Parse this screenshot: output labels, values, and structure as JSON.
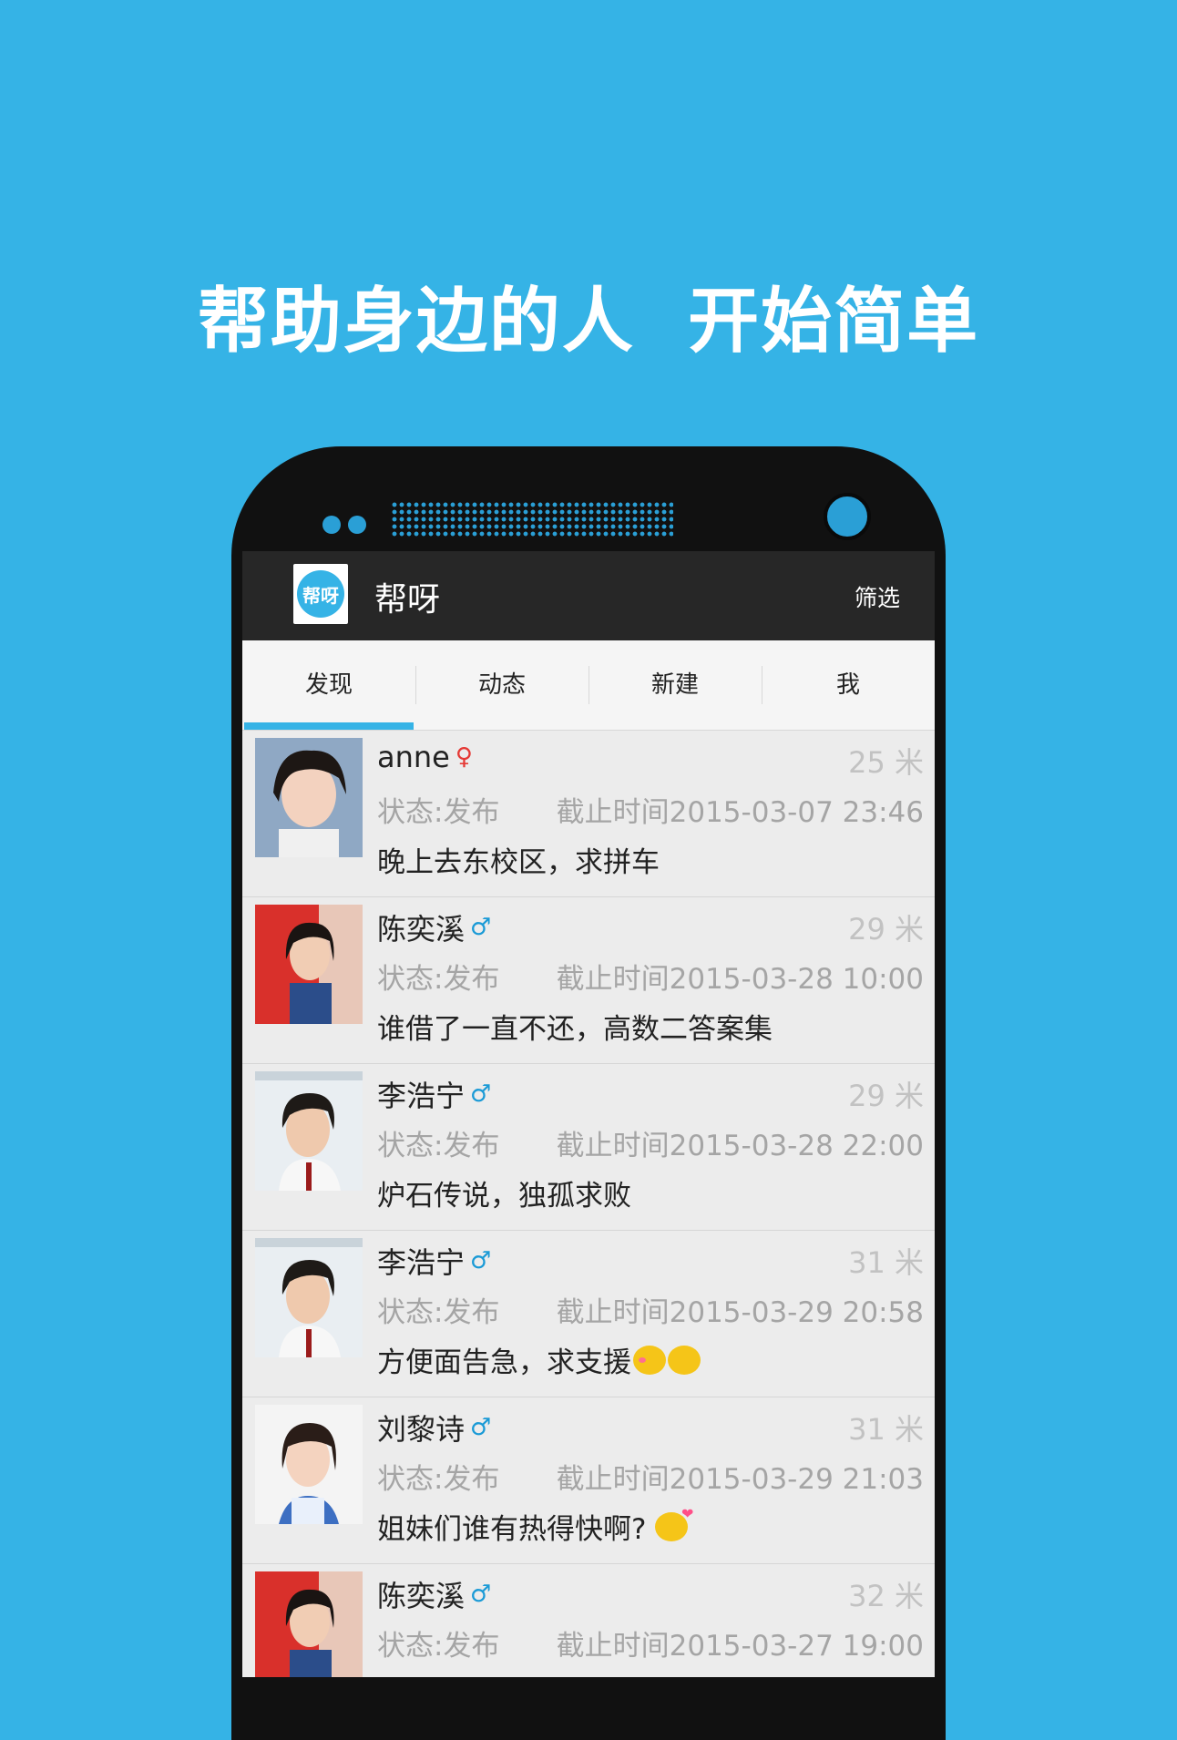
{
  "headline": "帮助身边的人  开始简单",
  "app": {
    "logo_text": "帮呀",
    "title": "帮呀",
    "filter_label": "筛选"
  },
  "tabs": [
    {
      "label": "发现",
      "active": true
    },
    {
      "label": "动态",
      "active": false
    },
    {
      "label": "新建",
      "active": false
    },
    {
      "label": "我",
      "active": false
    }
  ],
  "feed": [
    {
      "name": "anne",
      "gender": "female",
      "gender_symbol": "♀",
      "distance": "25 米",
      "status": "状态:发布",
      "deadline": "截止时间2015-03-07 23:46",
      "text": "晚上去东校区，求拼车",
      "emojis": []
    },
    {
      "name": "陈奕溪",
      "gender": "male",
      "gender_symbol": "♂",
      "distance": "29 米",
      "status": "状态:发布",
      "deadline": "截止时间2015-03-28 10:00",
      "text": "谁借了一直不还，高数二答案集",
      "emojis": []
    },
    {
      "name": "李浩宁",
      "gender": "male",
      "gender_symbol": "♂",
      "distance": "29 米",
      "status": "状态:发布",
      "deadline": "截止时间2015-03-28 22:00",
      "text": "炉石传说，独孤求败",
      "emojis": []
    },
    {
      "name": "李浩宁",
      "gender": "male",
      "gender_symbol": "♂",
      "distance": "31 米",
      "status": "状态:发布",
      "deadline": "截止时间2015-03-29 20:58",
      "text": "方便面告急，求支援",
      "emojis": [
        "blush-emoji",
        "plead-emoji"
      ]
    },
    {
      "name": "刘黎诗",
      "gender": "male",
      "gender_symbol": "♂",
      "distance": "31 米",
      "status": "状态:发布",
      "deadline": "截止时间2015-03-29 21:03",
      "text": "姐妹们谁有热得快啊?",
      "emojis": [
        "kiss-emoji"
      ]
    },
    {
      "name": "陈奕溪",
      "gender": "male",
      "gender_symbol": "♂",
      "distance": "32 米",
      "status": "状态:发布",
      "deadline": "截止时间2015-03-27 19:00",
      "text": "",
      "emojis": []
    }
  ],
  "colors": {
    "background": "#35b3e6",
    "accent": "#35b3e6",
    "appbar": "#272727",
    "female": "#e53935",
    "male": "#1a9ad6"
  }
}
